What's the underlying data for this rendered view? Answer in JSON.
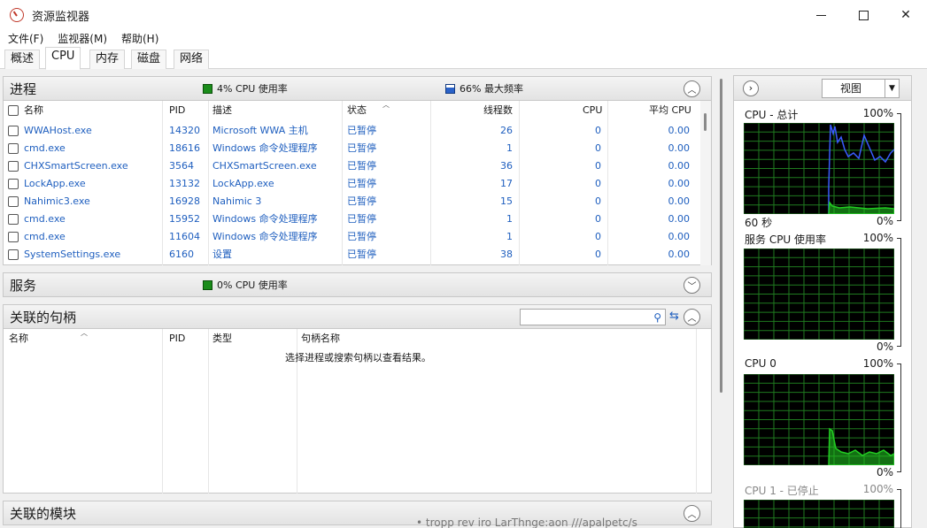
{
  "window": {
    "title": "资源监视器",
    "minimize": "—",
    "close": "✕"
  },
  "menu": [
    "文件(F)",
    "监视器(M)",
    "帮助(H)"
  ],
  "tabs": [
    "概述",
    "CPU",
    "内存",
    "磁盘",
    "网络"
  ],
  "processes": {
    "title": "进程",
    "cpu_usage": "4% CPU 使用率",
    "max_freq": "66% 最大频率",
    "columns": [
      "名称",
      "PID",
      "描述",
      "状态",
      "线程数",
      "CPU",
      "平均 CPU"
    ],
    "rows": [
      {
        "name": "WWAHost.exe",
        "pid": "14320",
        "desc": "Microsoft WWA 主机",
        "status": "已暂停",
        "threads": "26",
        "cpu": "0",
        "avg": "0.00"
      },
      {
        "name": "cmd.exe",
        "pid": "18616",
        "desc": "Windows 命令处理程序",
        "status": "已暂停",
        "threads": "1",
        "cpu": "0",
        "avg": "0.00"
      },
      {
        "name": "CHXSmartScreen.exe",
        "pid": "3564",
        "desc": "CHXSmartScreen.exe",
        "status": "已暂停",
        "threads": "36",
        "cpu": "0",
        "avg": "0.00"
      },
      {
        "name": "LockApp.exe",
        "pid": "13132",
        "desc": "LockApp.exe",
        "status": "已暂停",
        "threads": "17",
        "cpu": "0",
        "avg": "0.00"
      },
      {
        "name": "Nahimic3.exe",
        "pid": "16928",
        "desc": "Nahimic 3",
        "status": "已暂停",
        "threads": "15",
        "cpu": "0",
        "avg": "0.00"
      },
      {
        "name": "cmd.exe",
        "pid": "15952",
        "desc": "Windows 命令处理程序",
        "status": "已暂停",
        "threads": "1",
        "cpu": "0",
        "avg": "0.00"
      },
      {
        "name": "cmd.exe",
        "pid": "11604",
        "desc": "Windows 命令处理程序",
        "status": "已暂停",
        "threads": "1",
        "cpu": "0",
        "avg": "0.00"
      },
      {
        "name": "SystemSettings.exe",
        "pid": "6160",
        "desc": "设置",
        "status": "已暂停",
        "threads": "38",
        "cpu": "0",
        "avg": "0.00"
      }
    ]
  },
  "services": {
    "title": "服务",
    "cpu_usage": "0% CPU 使用率"
  },
  "handles": {
    "title": "关联的句柄",
    "search_value": "",
    "columns": [
      "名称",
      "PID",
      "类型",
      "句柄名称"
    ],
    "empty_message": "选择进程或搜索句柄以查看结果。"
  },
  "modules": {
    "title": "关联的模块"
  },
  "bleed_text": "• tropp      rev iro    LarThnge:aon ///apalpetc/s",
  "right_panel": {
    "view_label": "视图",
    "graphs": [
      {
        "title": "CPU - 总计",
        "max": "100%",
        "time": "60 秒",
        "min": "0%"
      },
      {
        "title": "服务 CPU 使用率",
        "max": "100%",
        "min": "0%"
      },
      {
        "title": "CPU 0",
        "max": "100%",
        "min": "0%"
      },
      {
        "title": "CPU 1 - 已停止",
        "max": "100%"
      }
    ]
  }
}
